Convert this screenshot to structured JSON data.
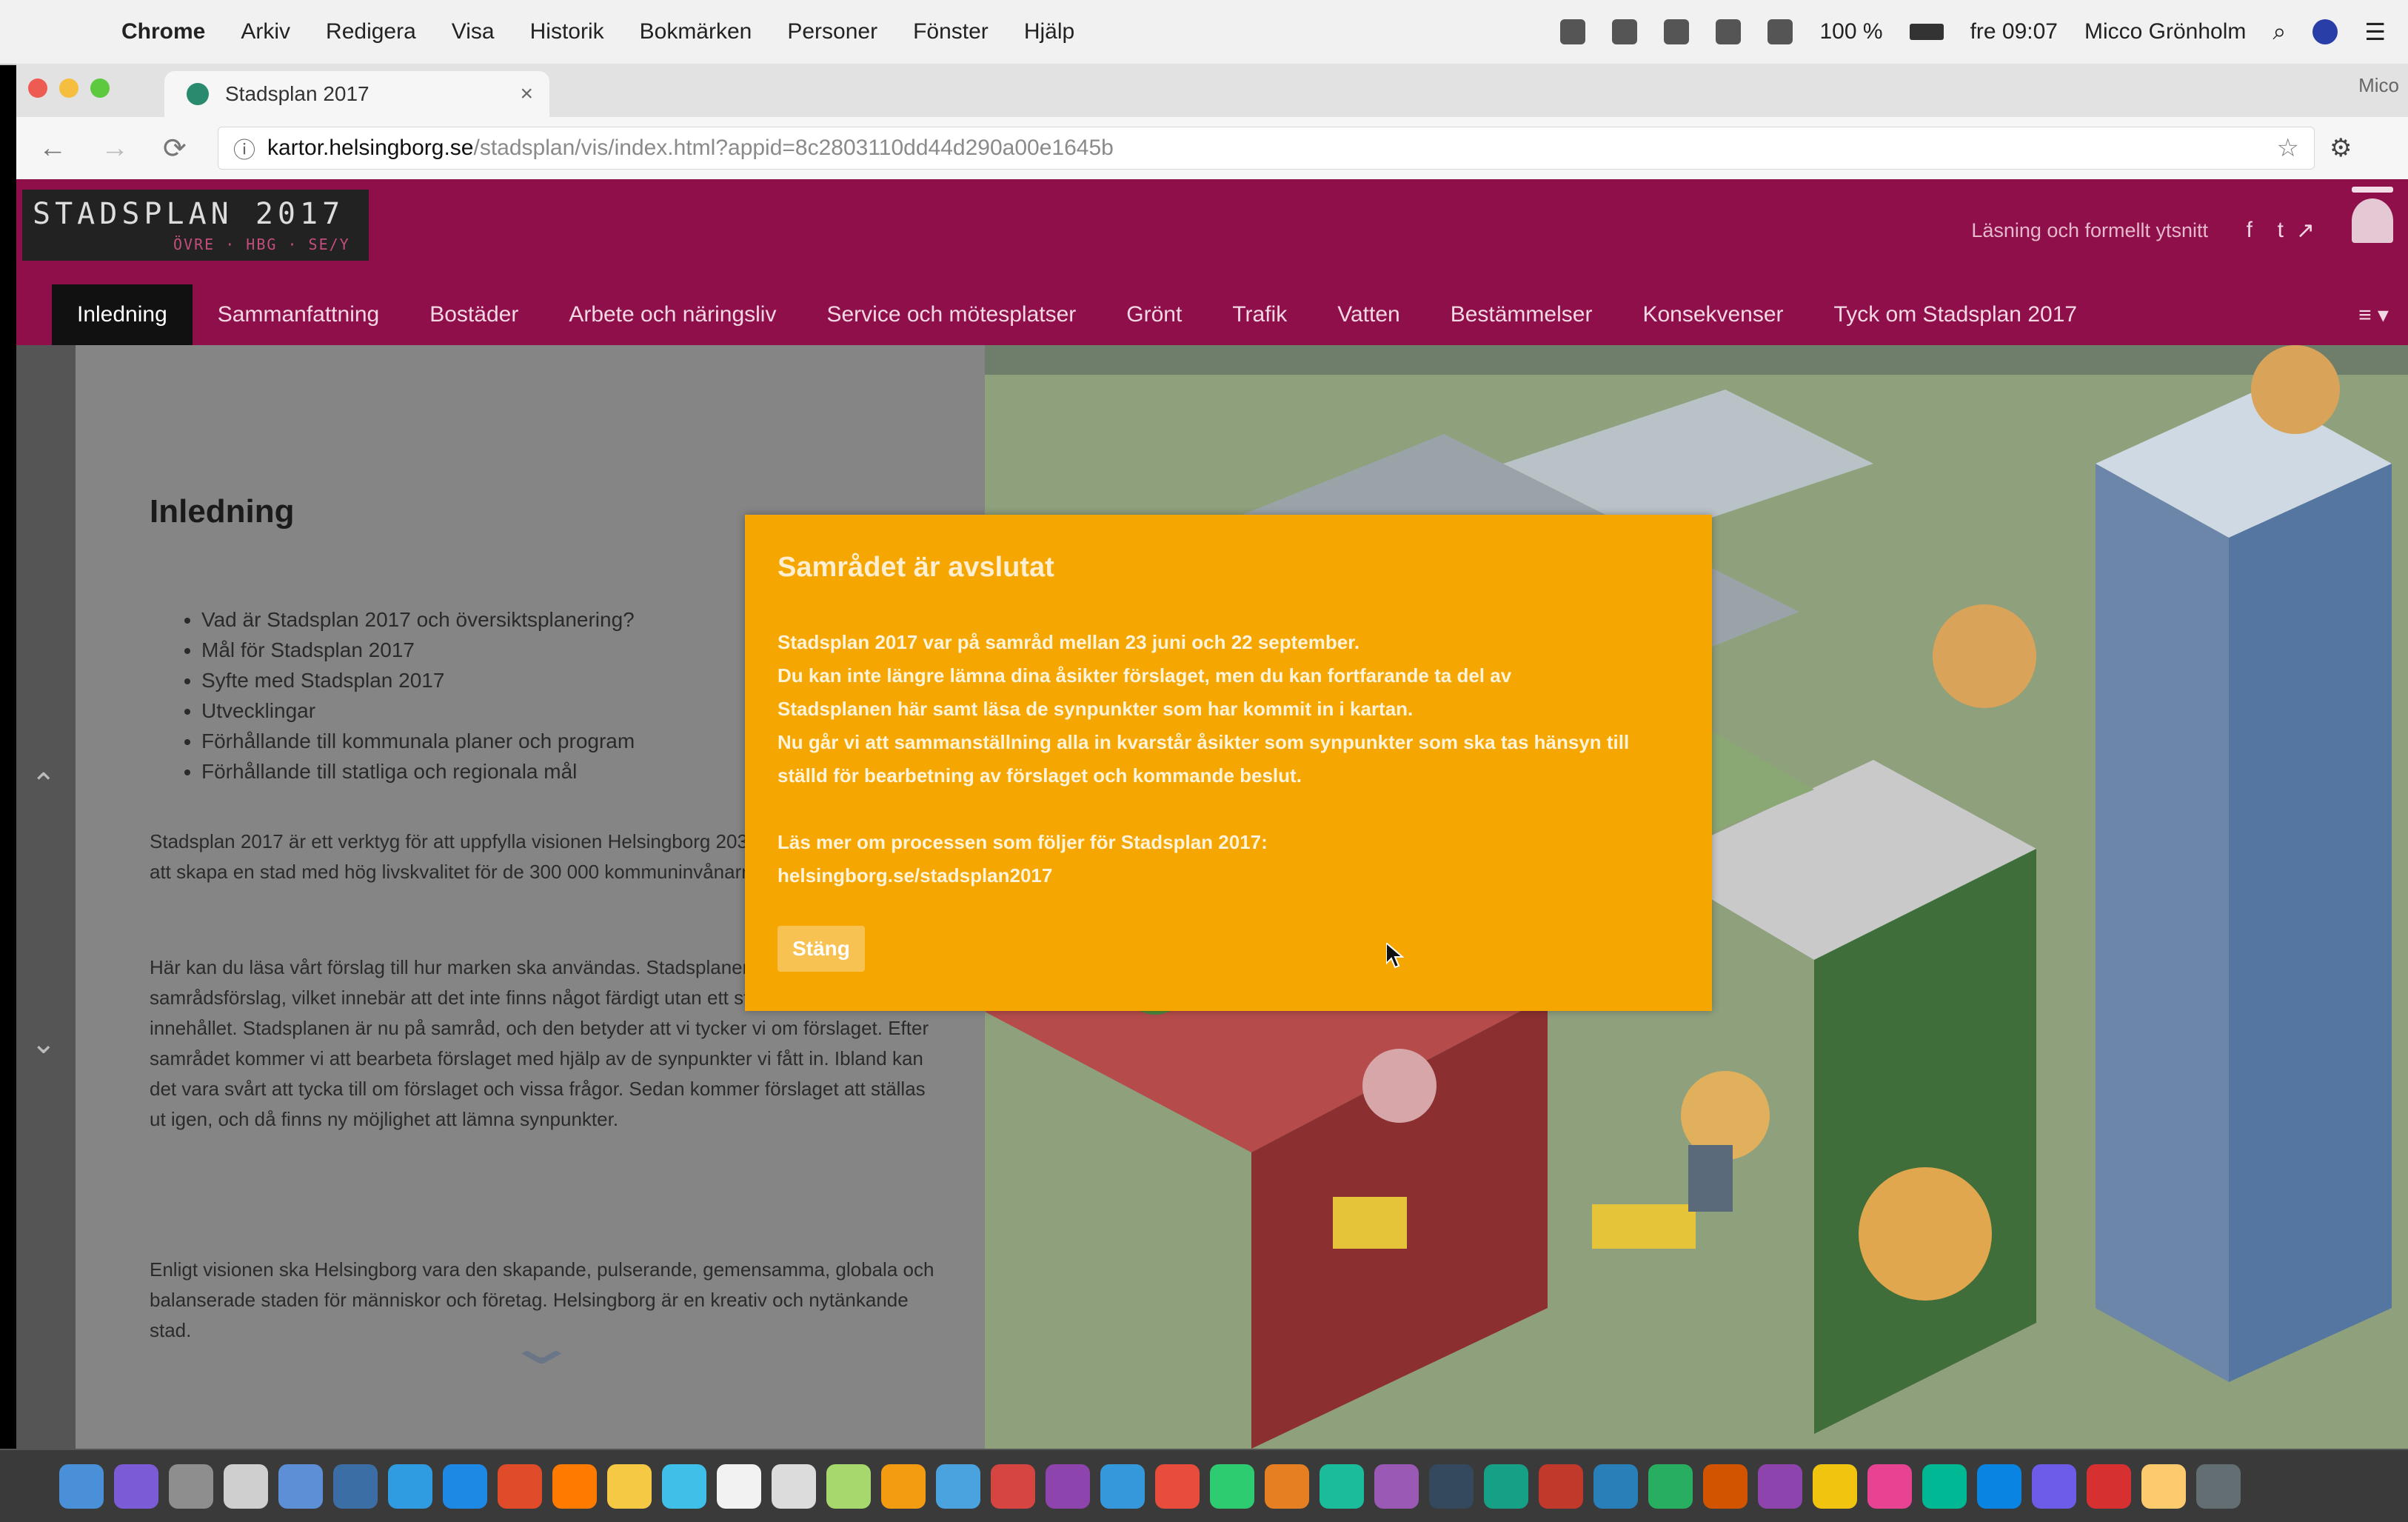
{
  "menubar": {
    "app": "Chrome",
    "menus": [
      "Chrome",
      "Arkiv",
      "Redigera",
      "Visa",
      "Historik",
      "Bokmärken",
      "Personer",
      "Fönster",
      "Hjälp"
    ],
    "battery": "100 %",
    "clock": "fre 09:07",
    "user": "Micco Grönholm"
  },
  "browser": {
    "tab_title": "Stadsplan 2017",
    "tab_close": "×",
    "profile": "Mico",
    "url_host": "kartor.helsingborg.se",
    "url_path": "/stadsplan/vis/index.html?appid=8c2803110dd44d290a00e1645b"
  },
  "site": {
    "logo_title": "STADSPLAN 2017",
    "logo_subtitle": "ÖVRE · HBG · SE/Y",
    "readability_link": "Läsning och formellt ytsnitt",
    "nav": [
      "Inledning",
      "Sammanfattning",
      "Bostäder",
      "Arbete och näringsliv",
      "Service och mötesplatser",
      "Grönt",
      "Trafik",
      "Vatten",
      "Bestämmelser",
      "Konsekvenser",
      "Tyck om Stadsplan 2017"
    ],
    "nav_more": "≡ ▾"
  },
  "article": {
    "heading": "Inledning",
    "toc": [
      "Vad är Stadsplan 2017 och översiktsplanering?",
      "Mål för Stadsplan 2017",
      "Syfte med Stadsplan 2017",
      "Utvecklingar",
      "Förhållande till kommunala planer och program",
      "Förhållande till statliga och regionala mål"
    ],
    "paragraphs": [
      "Stadsplan 2017 är ett verktyg för att uppfylla visionen Helsingborg 2035 och göra det möjligt att skapa en stad med hög livskvalitet för de 300 000 kommuninvånarna.",
      "Här kan du läsa vårt förslag till hur marken ska användas. Stadsplanen är ett samrådsförslag, vilket innebär att det inte finns något färdigt utan ett ställningstagande kring innehållet. Stadsplanen är nu på samråd, och den betyder att vi tycker vi om förslaget. Efter samrådet kommer vi att bearbeta förslaget med hjälp av de synpunkter vi fått in. Ibland kan det vara svårt att tycka till om förslaget och vissa frågor. Sedan kommer förslaget att ställas ut igen, och då finns ny möjlighet att lämna synpunkter.",
      "Enligt visionen ska Helsingborg vara den skapande, pulserande, gemensamma, globala och balanserade staden för människor och företag. Helsingborg är en kreativ och nytänkande stad."
    ]
  },
  "modal": {
    "title": "Samrådet är avslutat",
    "lines": [
      "Stadsplan 2017 var på samråd mellan 23 juni och 22 september.",
      "Du kan inte längre lämna dina åsikter förslaget, men du kan fortfarande ta del av",
      "Stadsplanen här samt läsa de synpunkter som har kommit in i kartan.",
      "Nu går vi att sammanställning alla in kvarstår åsikter som synpunkter som ska tas hänsyn till",
      "ställd för bearbetning av förslaget och kommande beslut."
    ],
    "more_lines": [
      "Läs mer om processen som följer för Stadsplan 2017:",
      "helsingborg.se/stadsplan2017"
    ],
    "close_label": "Stäng"
  },
  "dock": {
    "colors": [
      "#4a90d9",
      "#7b5bd6",
      "#8e8e8e",
      "#cfcfcf",
      "#5d8fd6",
      "#3b6ea5",
      "#2f9be0",
      "#1e88e5",
      "#e04b2a",
      "#ff7b00",
      "#f6c945",
      "#3ec0e8",
      "#f2f2f2",
      "#dcdcdc",
      "#a7d86d",
      "#f39c12",
      "#4aa3df",
      "#d64541",
      "#8e44ad",
      "#3498db",
      "#e74c3c",
      "#2ecc71",
      "#e67e22",
      "#1abc9c",
      "#9b59b6",
      "#34495e",
      "#16a085",
      "#c0392b",
      "#2980b9",
      "#27ae60",
      "#d35400",
      "#8e44ad",
      "#f1c40f",
      "#e84393",
      "#00b894",
      "#0984e3",
      "#6c5ce7",
      "#d63031",
      "#fdcb6e",
      "#636e72"
    ]
  }
}
